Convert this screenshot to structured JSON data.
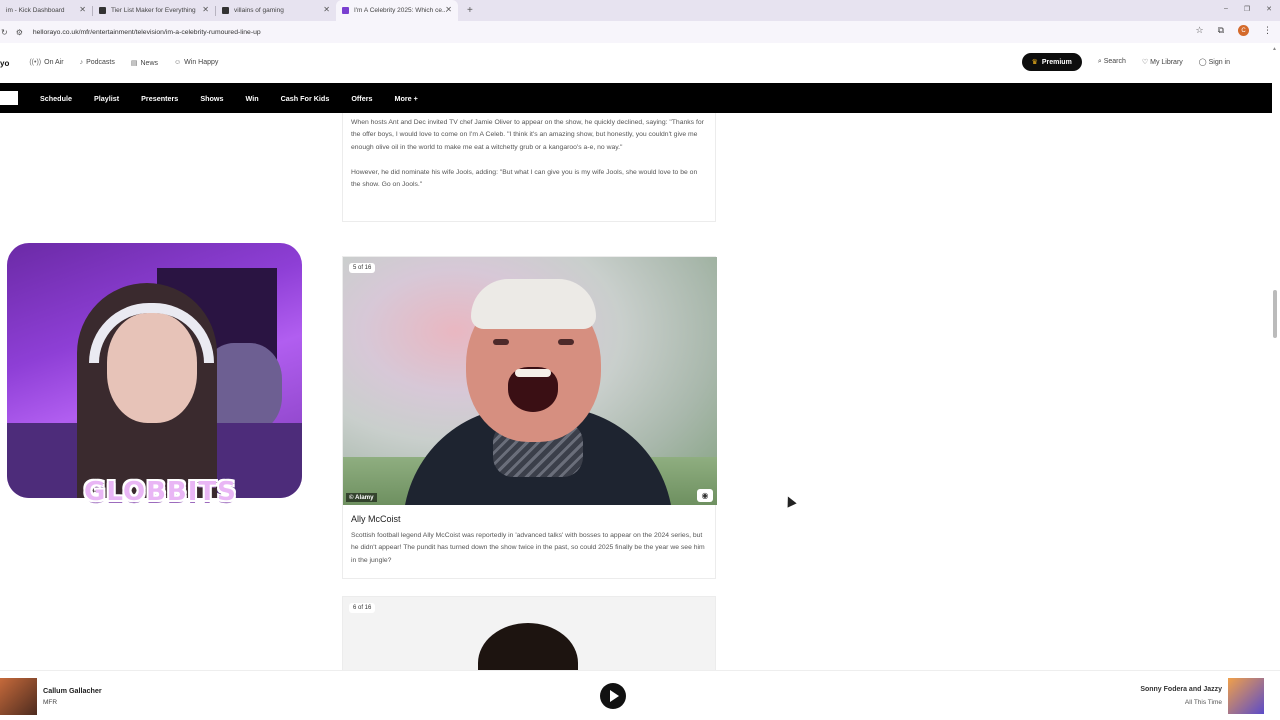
{
  "browser": {
    "tabs": [
      {
        "label": "im - Kick Dashboard"
      },
      {
        "label": "Tier List Maker for Everything"
      },
      {
        "label": "villains of gaming"
      },
      {
        "label": "I'm A Celebrity 2025: Which ce..."
      }
    ],
    "url": "hellorayo.co.uk/mfr/entertainment/television/im-a-celebrity-rumoured-line-up",
    "profile_initial": "C"
  },
  "site": {
    "logo": "yo",
    "top_nav": [
      {
        "label": "On Air",
        "icon": "radio-icon"
      },
      {
        "label": "Podcasts",
        "icon": "mic-icon"
      },
      {
        "label": "News",
        "icon": "news-icon"
      },
      {
        "label": "Win Happy",
        "icon": "smile-icon"
      }
    ],
    "premium_label": "Premium",
    "search_label": "Search",
    "library_label": "My Library",
    "signin_label": "Sign in",
    "main_nav": [
      "Schedule",
      "Playlist",
      "Presenters",
      "Shows",
      "Win",
      "Cash For Kids",
      "Offers",
      "More +"
    ]
  },
  "article": {
    "prev_card": {
      "para1": "When hosts Ant and Dec invited TV chef Jamie Oliver to appear on the show, he quickly declined, saying: \"Thanks for the offer boys, I would love to come on I'm A Celeb. \"I think it's an amazing show, but honestly, you couldn't give me enough olive oil in the world to make me eat a witchetty grub or a kangaroo's a-e, no way.\"",
      "para2": "However, he did nominate his wife Jools, adding: \"But what I can give you is my wife Jools, she would love to be on the show. Go on Jools.\""
    },
    "card1": {
      "counter": "5 of 16",
      "credit": "© Alamy",
      "title": "Ally McCoist",
      "description": "Scottish football legend Ally McCoist was reportedly in 'advanced talks' with bosses to appear on the 2024 series, but he didn't appear! The pundit has turned down the show twice in the past, so could 2025 finally be the year we see him in the jungle?"
    },
    "card2": {
      "counter": "6 of 16"
    }
  },
  "webcam": {
    "brand": "GLOBBITS"
  },
  "player": {
    "now_playing": "Callum Gallacher",
    "station": "MFR",
    "next_artist": "Sonny Fodera and Jazzy",
    "next_song": "All This Time"
  }
}
